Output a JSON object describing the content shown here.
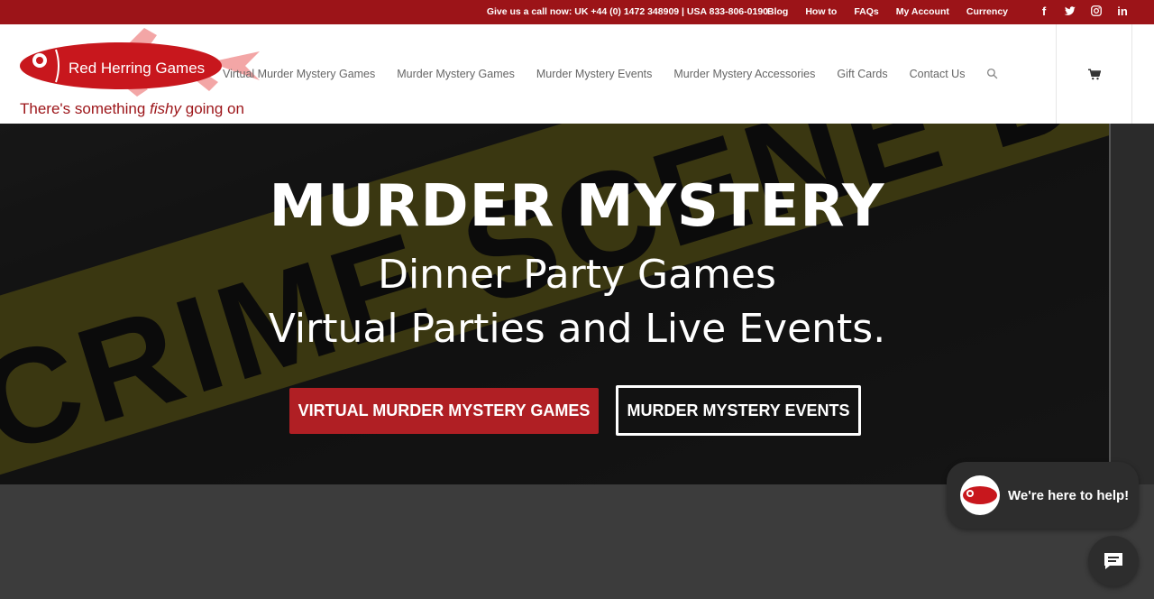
{
  "topbar": {
    "phone": "Give us a call now: UK +44 (0) 1472 348909 | USA 833-806-0190",
    "links": [
      "Blog",
      "How to",
      "FAQs",
      "My Account",
      "Currency"
    ],
    "social": [
      "facebook-icon",
      "twitter-icon",
      "instagram-icon",
      "linkedin-icon"
    ],
    "color": "#9c1418"
  },
  "logo": {
    "name": "Red Herring Games",
    "tagline_pre": "There's something ",
    "tagline_em": "fishy",
    "tagline_post": " going on"
  },
  "nav": {
    "items": [
      "Virtual Murder Mystery Games",
      "Murder Mystery Games",
      "Murder Mystery Events",
      "Murder Mystery Accessories",
      "Gift Cards",
      "Contact Us"
    ],
    "search_icon": "search-icon",
    "cart_icon": "cart-icon"
  },
  "hero": {
    "title": "MURDER MYSTERY",
    "subtitle_1": "Dinner Party Games",
    "subtitle_2": "Virtual Parties and Live Events.",
    "tape_text": "CRIME SCENE DO NOT CROSS",
    "button_primary": "VIRTUAL MURDER MYSTERY GAMES",
    "button_secondary": "MURDER MYSTERY EVENTS",
    "accent": "#b01f24"
  },
  "chat": {
    "text": "We're here to help!",
    "icon": "chat-icon"
  }
}
